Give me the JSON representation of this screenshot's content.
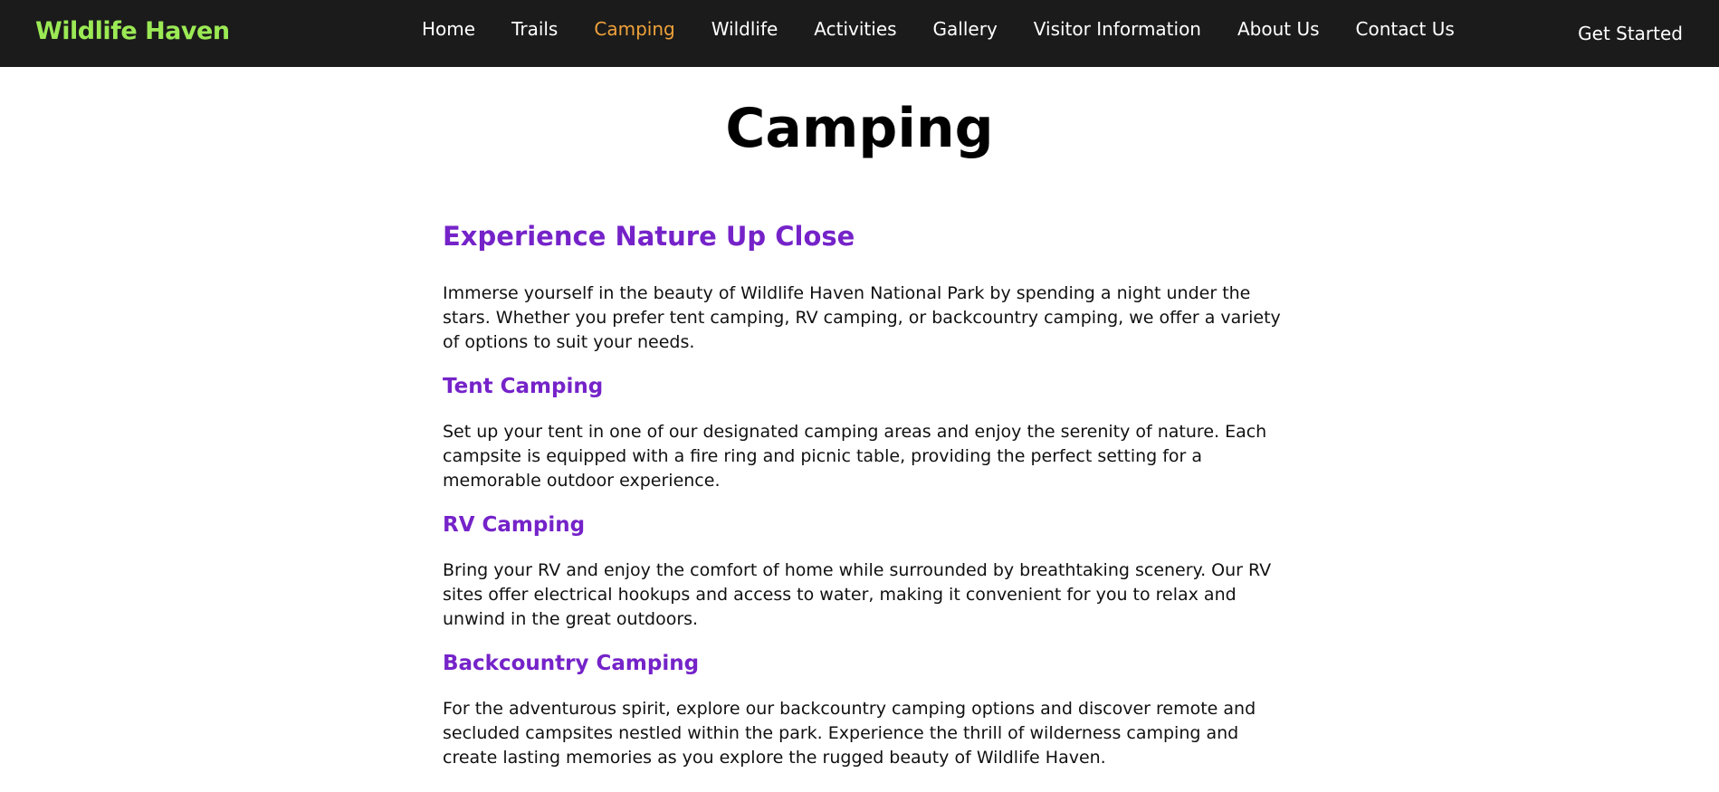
{
  "nav": {
    "brand": "Wildlife Haven",
    "links": [
      {
        "label": "Home",
        "active": false
      },
      {
        "label": "Trails",
        "active": false
      },
      {
        "label": "Camping",
        "active": true
      },
      {
        "label": "Wildlife",
        "active": false
      },
      {
        "label": "Activities",
        "active": false
      },
      {
        "label": "Gallery",
        "active": false
      },
      {
        "label": "Visitor Information",
        "active": false
      },
      {
        "label": "About Us",
        "active": false
      },
      {
        "label": "Contact Us",
        "active": false
      }
    ],
    "cta": "Get Started",
    "active_color": "#f0a23a",
    "brand_color": "#9bea55",
    "background": "#1b1b1b"
  },
  "page": {
    "title": "Camping"
  },
  "content": {
    "heading_color": "#7523c9",
    "intro": {
      "heading": "Experience Nature Up Close",
      "text": "Immerse yourself in the beauty of Wildlife Haven National Park by spending a night under the stars. Whether you prefer tent camping, RV camping, or backcountry camping, we offer a variety of options to suit your needs."
    },
    "sections": [
      {
        "heading": "Tent Camping",
        "text": "Set up your tent in one of our designated camping areas and enjoy the serenity of nature. Each campsite is equipped with a fire ring and picnic table, providing the perfect setting for a memorable outdoor experience."
      },
      {
        "heading": "RV Camping",
        "text": "Bring your RV and enjoy the comfort of home while surrounded by breathtaking scenery. Our RV sites offer electrical hookups and access to water, making it convenient for you to relax and unwind in the great outdoors."
      },
      {
        "heading": "Backcountry Camping",
        "text": "For the adventurous spirit, explore our backcountry camping options and discover remote and secluded campsites nestled within the park. Experience the thrill of wilderness camping and create lasting memories as you explore the rugged beauty of Wildlife Haven."
      }
    ]
  }
}
